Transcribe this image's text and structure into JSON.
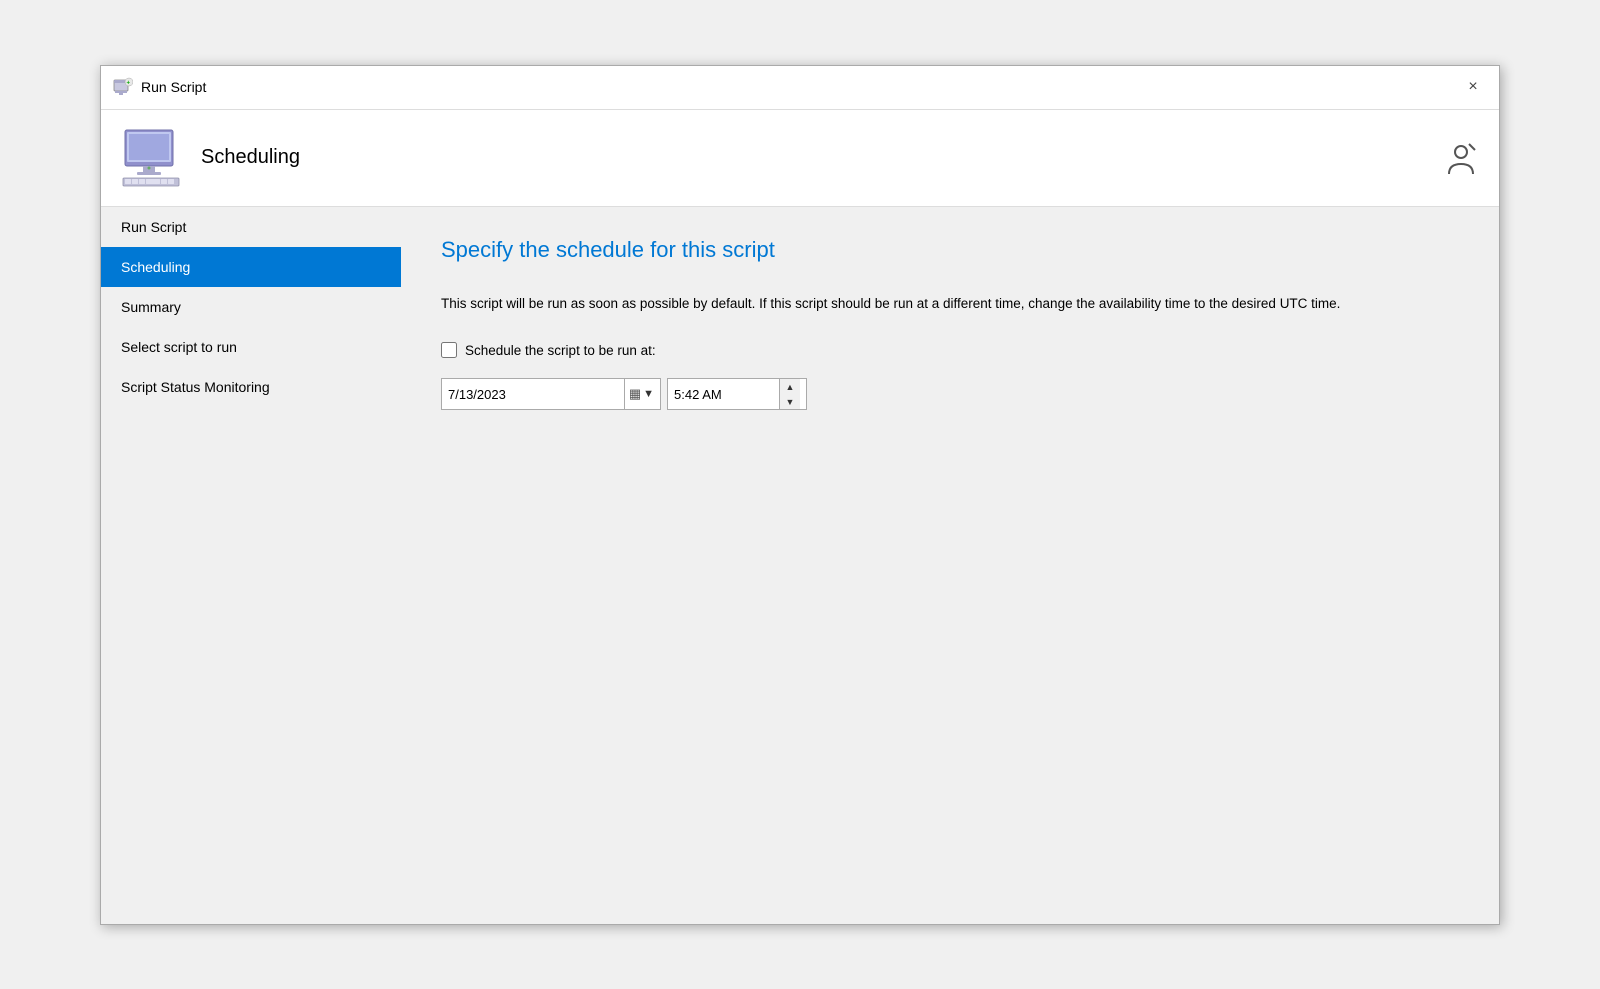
{
  "window": {
    "title": "Run Script",
    "close_label": "×"
  },
  "header": {
    "title": "Scheduling",
    "help_icon": "help-icon"
  },
  "sidebar": {
    "items": [
      {
        "id": "run-script",
        "label": "Run Script",
        "active": false
      },
      {
        "id": "scheduling",
        "label": "Scheduling",
        "active": true
      },
      {
        "id": "summary",
        "label": "Summary",
        "active": false
      },
      {
        "id": "select-script",
        "label": "Select script to run",
        "active": false
      },
      {
        "id": "script-status",
        "label": "Script Status Monitoring",
        "active": false
      }
    ]
  },
  "content": {
    "title": "Specify the schedule for this script",
    "description": "This script will be run as soon as possible by default. If this script should be run at a different time, change the availability time to the desired UTC time.",
    "checkbox_label": "Schedule the script to be run at:",
    "date_value": "7/13/2023",
    "time_value": "5:42 AM"
  },
  "icons": {
    "up_arrow": "▲",
    "down_arrow": "▼",
    "calendar": "▦",
    "dropdown": "▼"
  }
}
